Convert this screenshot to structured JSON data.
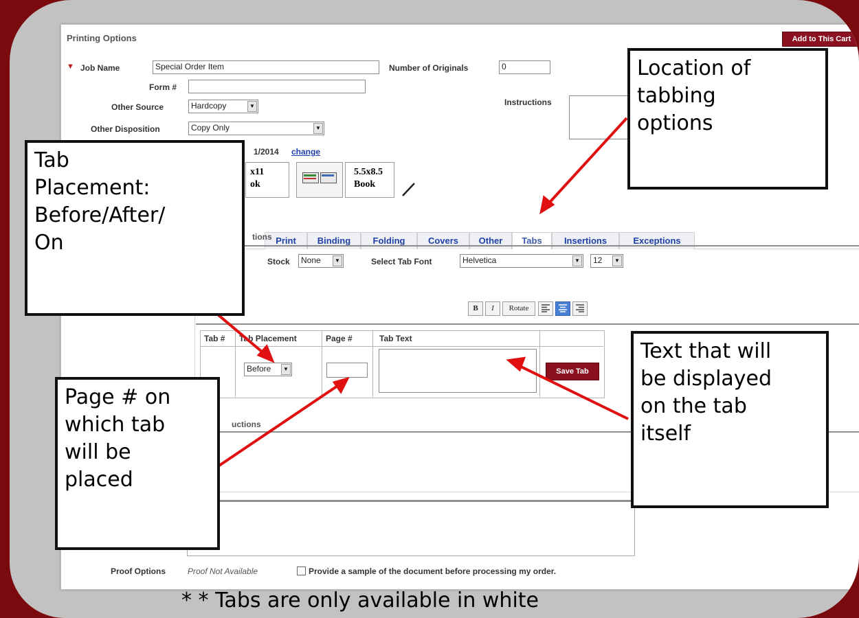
{
  "panel": {
    "title": "Printing Options",
    "add_to_cart": "Add to This Cart"
  },
  "form": {
    "job_name_label": "Job Name",
    "job_name_value": "Special Order Item",
    "num_originals_label": "Number of Originals",
    "num_originals_value": "0",
    "form_no_label": "Form #",
    "form_no_value": "",
    "other_source_label": "Other Source",
    "other_source_value": "Hardcopy",
    "instructions_label": "Instructions",
    "other_disposition_label": "Other Disposition",
    "other_disposition_value": "Copy Only",
    "date_fragment": "1/2014",
    "change_link": "change"
  },
  "presets": [
    {
      "line1": "x11",
      "line2": "ok"
    },
    {
      "line1": "5.5x8.5",
      "line2": "Book"
    }
  ],
  "tabs": [
    "Print",
    "Binding",
    "Folding",
    "Covers",
    "Other",
    "Tabs",
    "Insertions",
    "Exceptions"
  ],
  "tab_options": {
    "section_fragment": "tions",
    "stock_label_fragment": "Stock",
    "stock_value": "None",
    "font_label": "Select Tab Font",
    "font_value": "Helvetica",
    "size_value": "12",
    "format_buttons": [
      "B",
      "I",
      "Rotate"
    ]
  },
  "tab_table": {
    "headers": [
      "Tab #",
      "Tab Placement",
      "Page #",
      "Tab Text"
    ],
    "placement_value": "Before",
    "page_value": "",
    "save_button": "Save Tab"
  },
  "instructions_fragment": "uctions",
  "proof": {
    "label": "Proof Options",
    "status": "Proof Not Available",
    "checkbox_label": "Provide a sample of the document before processing my order."
  },
  "callouts": {
    "location": [
      "Location of",
      "tabbing",
      "options"
    ],
    "placement": [
      "Tab",
      "Placement:",
      "Before/After/",
      "On"
    ],
    "text": [
      "Text that will",
      "be displayed",
      "on the tab",
      "itself"
    ],
    "page": [
      "Page # on",
      "which tab",
      "will be",
      "placed"
    ]
  },
  "footnote": "* * Tabs are only available in white",
  "colors": {
    "background": "#7a0a0e",
    "save_button": "#8b1020",
    "arrow": "#e01010",
    "link": "#1f3fa6"
  }
}
